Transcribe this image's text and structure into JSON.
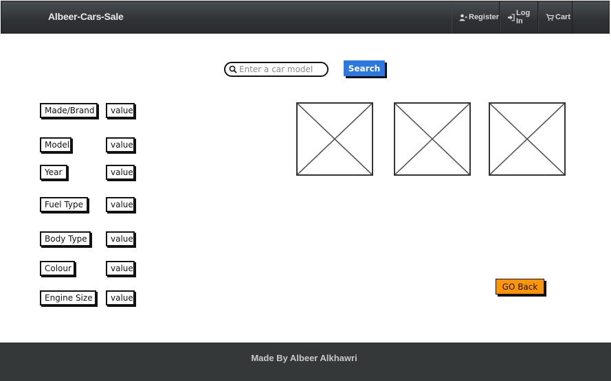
{
  "navbar": {
    "brand": "Albeer-Cars-Sale",
    "items": [
      {
        "label": "Register",
        "icon": "user-add-icon"
      },
      {
        "label": "Log In",
        "icon": "login-icon"
      },
      {
        "label": "Cart",
        "icon": "cart-icon"
      }
    ]
  },
  "search": {
    "placeholder": "Enter a car model",
    "value": "",
    "button_label": "Search",
    "button_color": "#2b78e4"
  },
  "specs": [
    {
      "label": "Made/Brand",
      "value": "value"
    },
    {
      "label": "Model",
      "value": "value"
    },
    {
      "label": "Year",
      "value": "value"
    },
    {
      "label": "Fuel Type",
      "value": "value"
    },
    {
      "label": "Body Type",
      "value": "value"
    },
    {
      "label": "Colour",
      "value": "value"
    },
    {
      "label": "Engine Size",
      "value": "value"
    }
  ],
  "images": [
    {
      "icon": "image-placeholder-icon"
    },
    {
      "icon": "image-placeholder-icon"
    },
    {
      "icon": "image-placeholder-icon"
    }
  ],
  "go_back": {
    "label": "GO Back",
    "color": "#ff9500"
  },
  "footer": {
    "text": "Made By Albeer Alkhawri"
  }
}
